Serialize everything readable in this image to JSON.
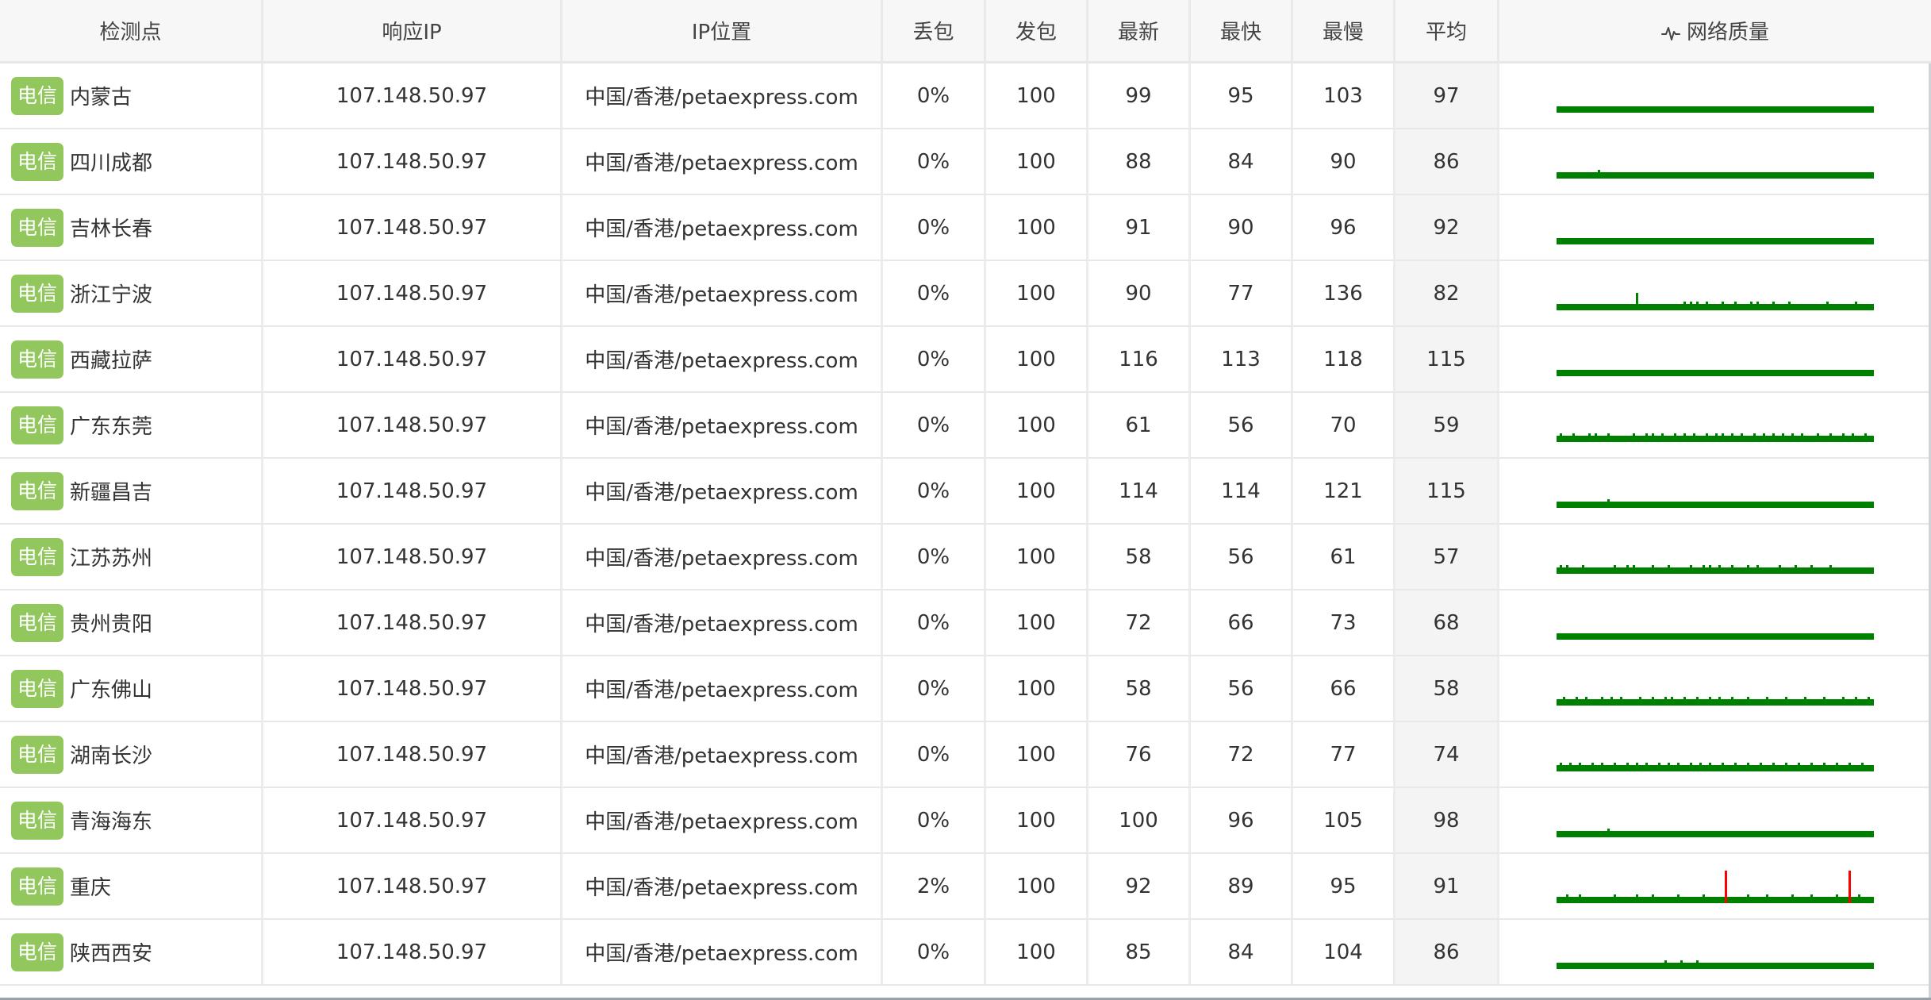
{
  "headers": {
    "point": "检测点",
    "ip": "响应IP",
    "location": "IP位置",
    "loss": "丢包",
    "sent": "发包",
    "latest": "最新",
    "fastest": "最快",
    "slowest": "最慢",
    "average": "平均",
    "quality": "网络质量",
    "quality_icon": "pulse-icon"
  },
  "colors": {
    "badge": "#91c75d",
    "spark_good": "#008000",
    "spark_loss": "#ff0000",
    "avg_column_bg": "#f4f4f4"
  },
  "rows": [
    {
      "isp": "电信",
      "point": "内蒙古",
      "ip": "107.148.50.97",
      "location": "中国/香港/petaexpress.com",
      "loss": "0%",
      "sent": "100",
      "latest": "99",
      "fastest": "95",
      "slowest": "103",
      "average": "97",
      "spikes": [],
      "loss_marks": []
    },
    {
      "isp": "电信",
      "point": "四川成都",
      "ip": "107.148.50.97",
      "location": "中国/香港/petaexpress.com",
      "loss": "0%",
      "sent": "100",
      "latest": "88",
      "fastest": "84",
      "slowest": "90",
      "average": "86",
      "spikes": [
        13
      ],
      "loss_marks": []
    },
    {
      "isp": "电信",
      "point": "吉林长春",
      "ip": "107.148.50.97",
      "location": "中国/香港/petaexpress.com",
      "loss": "0%",
      "sent": "100",
      "latest": "91",
      "fastest": "90",
      "slowest": "96",
      "average": "92",
      "spikes": [],
      "loss_marks": []
    },
    {
      "isp": "电信",
      "point": "浙江宁波",
      "ip": "107.148.50.97",
      "location": "中国/香港/petaexpress.com",
      "loss": "0%",
      "sent": "100",
      "latest": "90",
      "fastest": "77",
      "slowest": "136",
      "average": "82",
      "spikes": [
        25,
        40,
        42,
        44,
        47,
        52,
        56,
        61,
        63,
        68,
        73,
        85,
        94
      ],
      "loss_marks": []
    },
    {
      "isp": "电信",
      "point": "西藏拉萨",
      "ip": "107.148.50.97",
      "location": "中国/香港/petaexpress.com",
      "loss": "0%",
      "sent": "100",
      "latest": "116",
      "fastest": "113",
      "slowest": "118",
      "average": "115",
      "spikes": [],
      "loss_marks": []
    },
    {
      "isp": "电信",
      "point": "广东东莞",
      "ip": "107.148.50.97",
      "location": "中国/香港/petaexpress.com",
      "loss": "0%",
      "sent": "100",
      "latest": "61",
      "fastest": "56",
      "slowest": "70",
      "average": "59",
      "spikes": [
        1,
        5,
        10,
        12,
        16,
        24,
        28,
        30,
        33,
        37,
        40,
        43,
        47,
        50,
        52,
        55,
        58,
        62,
        65,
        68,
        71,
        74,
        77,
        82,
        86,
        90,
        93,
        97
      ],
      "loss_marks": []
    },
    {
      "isp": "电信",
      "point": "新疆昌吉",
      "ip": "107.148.50.97",
      "location": "中国/香港/petaexpress.com",
      "loss": "0%",
      "sent": "100",
      "latest": "114",
      "fastest": "114",
      "slowest": "121",
      "average": "115",
      "spikes": [
        16
      ],
      "loss_marks": []
    },
    {
      "isp": "电信",
      "point": "江苏苏州",
      "ip": "107.148.50.97",
      "location": "中国/香港/petaexpress.com",
      "loss": "0%",
      "sent": "100",
      "latest": "58",
      "fastest": "56",
      "slowest": "61",
      "average": "57",
      "spikes": [
        1,
        3,
        8,
        18,
        22,
        24,
        30,
        35,
        42,
        46,
        48,
        51,
        55,
        60,
        63,
        70,
        75,
        80,
        86
      ],
      "loss_marks": []
    },
    {
      "isp": "电信",
      "point": "贵州贵阳",
      "ip": "107.148.50.97",
      "location": "中国/香港/petaexpress.com",
      "loss": "0%",
      "sent": "100",
      "latest": "72",
      "fastest": "66",
      "slowest": "73",
      "average": "68",
      "spikes": [],
      "loss_marks": []
    },
    {
      "isp": "电信",
      "point": "广东佛山",
      "ip": "107.148.50.97",
      "location": "中国/香港/petaexpress.com",
      "loss": "0%",
      "sent": "100",
      "latest": "58",
      "fastest": "56",
      "slowest": "66",
      "average": "58",
      "spikes": [
        2,
        6,
        9,
        14,
        17,
        20,
        26,
        30,
        34,
        36,
        40,
        44,
        48,
        51,
        55,
        60,
        66,
        72,
        78,
        84,
        90,
        94,
        98
      ],
      "loss_marks": []
    },
    {
      "isp": "电信",
      "point": "湖南长沙",
      "ip": "107.148.50.97",
      "location": "中国/香港/petaexpress.com",
      "loss": "0%",
      "sent": "100",
      "latest": "76",
      "fastest": "72",
      "slowest": "77",
      "average": "74",
      "spikes": [
        1,
        4,
        7,
        11,
        14,
        18,
        22,
        25,
        28,
        32,
        35,
        38,
        42,
        45,
        48,
        52,
        56,
        60,
        64,
        68,
        72,
        76,
        80,
        84,
        88,
        92,
        96
      ],
      "loss_marks": []
    },
    {
      "isp": "电信",
      "point": "青海海东",
      "ip": "107.148.50.97",
      "location": "中国/香港/petaexpress.com",
      "loss": "0%",
      "sent": "100",
      "latest": "100",
      "fastest": "96",
      "slowest": "105",
      "average": "98",
      "spikes": [
        16
      ],
      "loss_marks": []
    },
    {
      "isp": "电信",
      "point": "重庆",
      "ip": "107.148.50.97",
      "location": "中国/香港/petaexpress.com",
      "loss": "2%",
      "sent": "100",
      "latest": "92",
      "fastest": "89",
      "slowest": "95",
      "average": "91",
      "spikes": [
        3,
        7,
        18,
        25,
        30,
        38,
        46,
        60,
        66,
        74,
        80,
        88,
        95
      ],
      "loss_marks": [
        53,
        92
      ]
    },
    {
      "isp": "电信",
      "point": "陕西西安",
      "ip": "107.148.50.97",
      "location": "中国/香港/petaexpress.com",
      "loss": "0%",
      "sent": "100",
      "latest": "85",
      "fastest": "84",
      "slowest": "104",
      "average": "86",
      "spikes": [
        34,
        39,
        44
      ],
      "loss_marks": []
    }
  ]
}
